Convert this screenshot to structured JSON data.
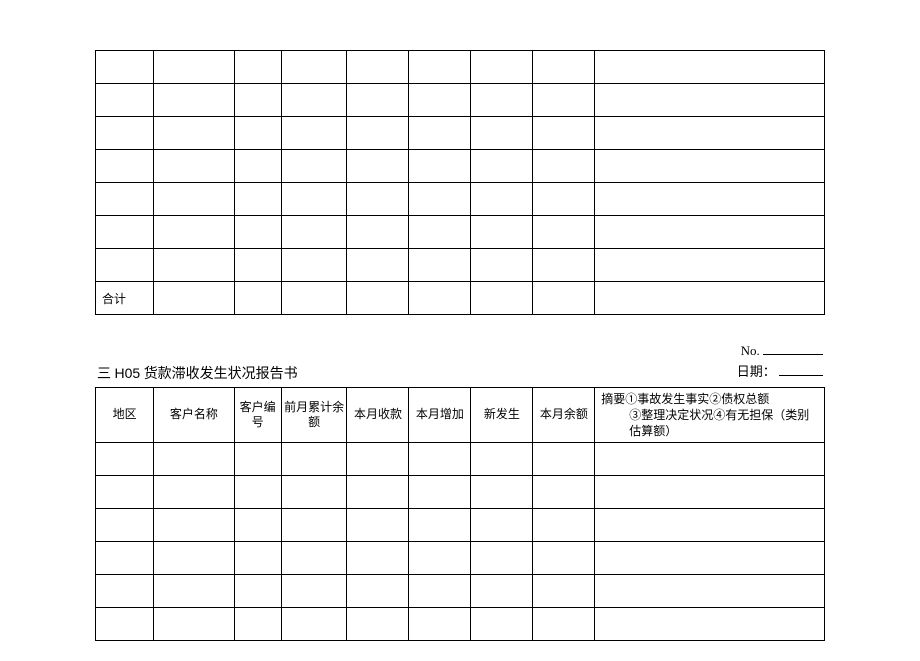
{
  "table1": {
    "total_label": "合计"
  },
  "section2": {
    "prefix": "三",
    "code": "H05",
    "title": "货款滞收发生状况报告书",
    "no_label": "No.",
    "date_label": "日期："
  },
  "table2": {
    "headers": {
      "region": "地区",
      "customer_name": "客户名称",
      "customer_no": "客户编号",
      "prev_balance": "前月累计余额",
      "this_month_receipt": "本月收款",
      "this_month_increase": "本月增加",
      "new_occur": "新发生",
      "this_month_balance": "本月余额",
      "summary_line1": "摘要①事故发生事实②债权总额",
      "summary_line2": "③整理决定状况④有无担保（类别估算额）"
    }
  }
}
